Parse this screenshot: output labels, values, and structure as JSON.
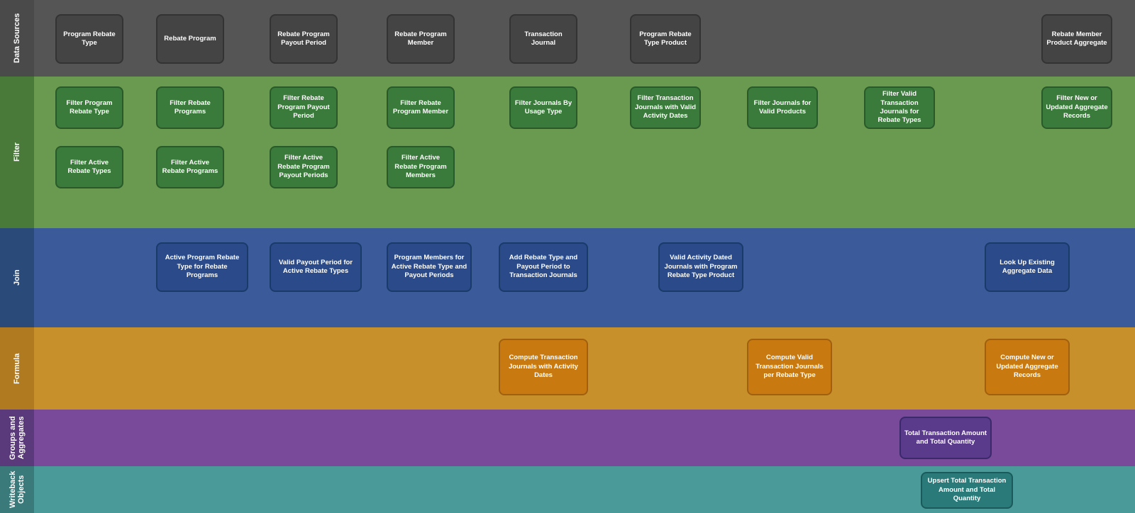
{
  "bands": [
    {
      "id": "data-sources",
      "label": "Data Sources"
    },
    {
      "id": "filter",
      "label": "Filter"
    },
    {
      "id": "join",
      "label": "Join"
    },
    {
      "id": "formula",
      "label": "Formula"
    },
    {
      "id": "groups",
      "label": "Groups and Aggregates"
    },
    {
      "id": "writeback",
      "label": "Writeback Objects"
    }
  ],
  "nodes": {
    "ds_program_rebate_type": "Program Rebate Type",
    "ds_rebate_program": "Rebate Program",
    "ds_rebate_program_payout": "Rebate Program Payout Period",
    "ds_rebate_program_member": "Rebate Program Member",
    "ds_transaction_journal": "Transaction Journal",
    "ds_program_rebate_type_product": "Program Rebate Type Product",
    "ds_rebate_member_product": "Rebate Member Product Aggregate",
    "f_filter_program_rebate_type": "Filter Program Rebate Type",
    "f_filter_rebate_programs": "Filter Rebate Programs",
    "f_filter_rebate_program_payout": "Filter Rebate Program Payout Period",
    "f_filter_rebate_program_member": "Filter Rebate Program Member",
    "f_filter_journals_by_usage": "Filter Journals By Usage Type",
    "f_filter_transaction_valid_activity": "Filter Transaction Journals with Valid Activity Dates",
    "f_filter_journals_valid_products": "Filter Journals for Valid Products",
    "f_filter_valid_transaction_rebate": "Filter Valid Transaction Journals for Rebate Types",
    "f_filter_new_updated": "Filter New or Updated Aggregate Records",
    "f_filter_active_rebate_types": "Filter Active Rebate Types",
    "f_filter_active_programs": "Filter Active Rebate Programs",
    "f_filter_active_payout": "Filter Active Rebate Program Payout Periods",
    "f_filter_active_members": "Filter Active Rebate Program Members",
    "j_active_program_rebate": "Active Program Rebate Type for Rebate Programs",
    "j_valid_payout": "Valid Payout Period for Active Rebate Types",
    "j_program_members": "Program Members for Active Rebate Type and Payout Periods",
    "j_add_rebate_type": "Add Rebate Type and Payout Period to Transaction Journals",
    "j_valid_activity": "Valid Activity Dated Journals with Program Rebate Type Product",
    "j_look_up": "Look Up Existing Aggregate Data",
    "fo_compute_transaction": "Compute Transaction Journals with Activity Dates",
    "fo_compute_valid": "Compute Valid Transaction Journals per Rebate Type",
    "fo_compute_aggregate": "Compute New or Updated Aggregate Records",
    "ga_total_transaction": "Total Transaction Amount and Total Quantity",
    "wb_upsert": "Upsert Total Transaction Amount and Total Quantity"
  }
}
